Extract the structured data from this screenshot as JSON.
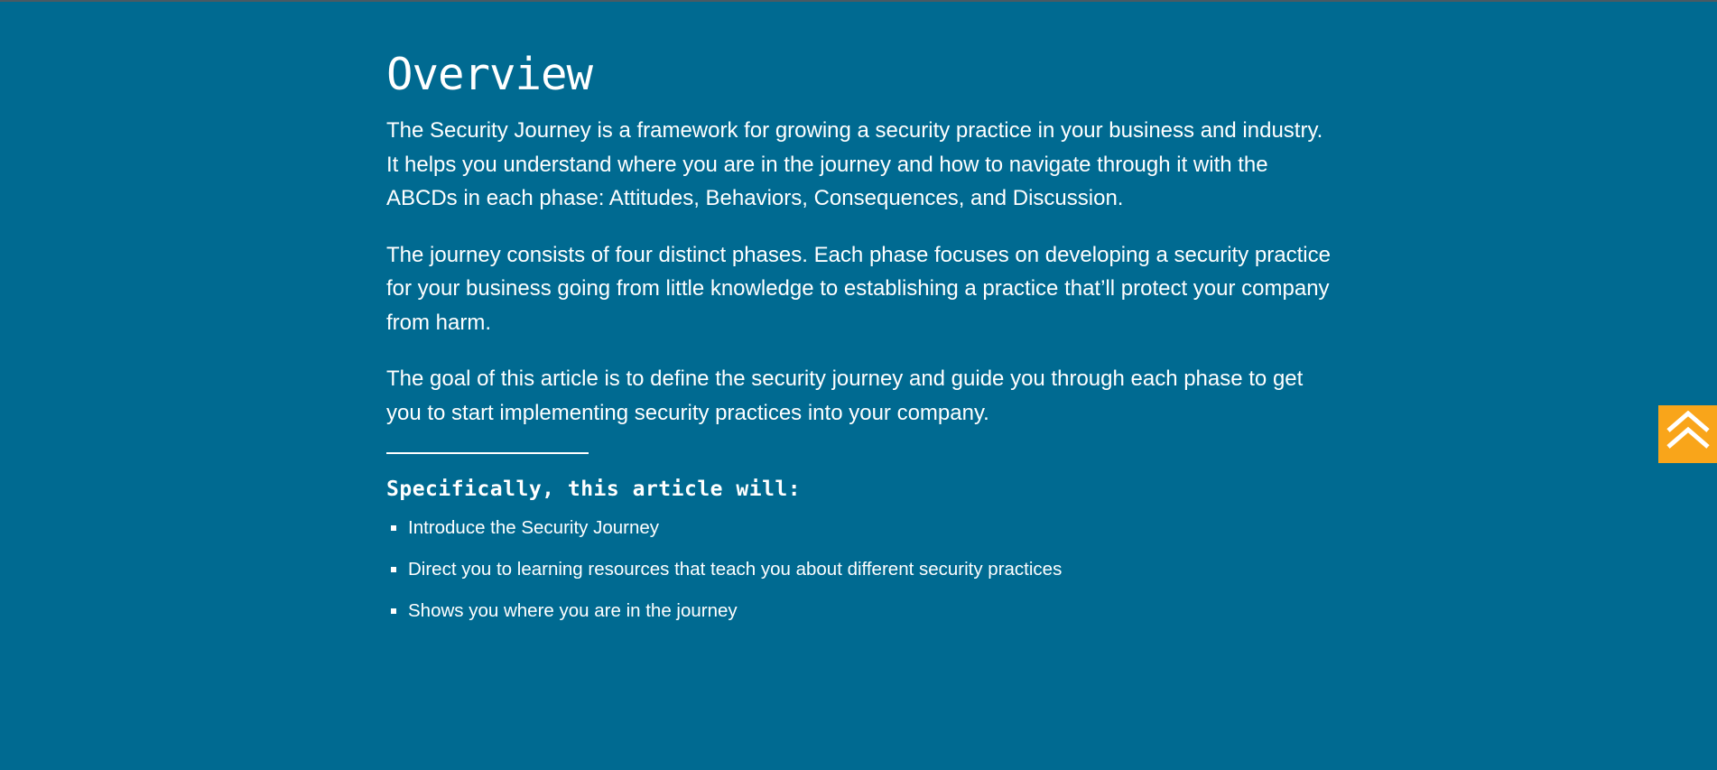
{
  "article": {
    "title": "Overview",
    "paragraphs": [
      "The Security Journey is a framework for growing a security practice in your business and industry. It helps you understand where you are in the journey and how to navigate through it with the ABCDs in each phase: Attitudes, Behaviors, Consequences, and Discussion.",
      "The journey consists of four distinct phases. Each phase focuses on developing a security practice for your business going from little knowledge to establishing a practice that’ll protect your company from harm.",
      "The goal of this article is to define the security journey and guide you through each phase to get you to start implementing security practices into your company."
    ],
    "subheading": "Specifically, this article will:",
    "list_items": [
      "Introduce the Security Journey",
      "Direct you to learning resources that teach you about different security practices",
      "Shows you where you are in the journey"
    ]
  },
  "back_to_top": {
    "icon": "double-chevron-up-icon"
  },
  "colors": {
    "background": "#006a91",
    "text": "#ffffff",
    "accent": "#f9a51a"
  }
}
